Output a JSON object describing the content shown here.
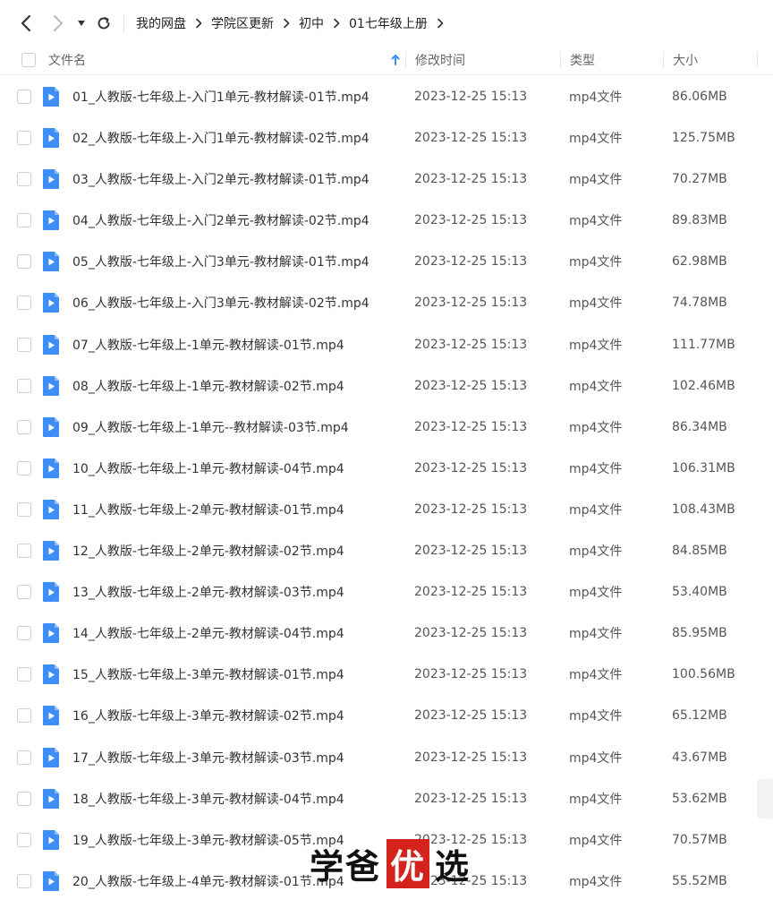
{
  "breadcrumb": [
    "我的网盘",
    "学院区更新",
    "初中",
    "01七年级上册"
  ],
  "header": {
    "name": "文件名",
    "time": "修改时间",
    "type": "类型",
    "size": "大小"
  },
  "colors": {
    "accent": "#3d8ef7",
    "watermark_highlight": "#d4231c"
  },
  "files": [
    {
      "name": "01_人教版-七年级上-入门1单元-教材解读-01节.mp4",
      "time": "2023-12-25 15:13",
      "type": "mp4文件",
      "size": "86.06MB"
    },
    {
      "name": "02_人教版-七年级上-入门1单元-教材解读-02节.mp4",
      "time": "2023-12-25 15:13",
      "type": "mp4文件",
      "size": "125.75MB"
    },
    {
      "name": "03_人教版-七年级上-入门2单元-教材解读-01节.mp4",
      "time": "2023-12-25 15:13",
      "type": "mp4文件",
      "size": "70.27MB"
    },
    {
      "name": "04_人教版-七年级上-入门2单元-教材解读-02节.mp4",
      "time": "2023-12-25 15:13",
      "type": "mp4文件",
      "size": "89.83MB"
    },
    {
      "name": "05_人教版-七年级上-入门3单元-教材解读-01节.mp4",
      "time": "2023-12-25 15:13",
      "type": "mp4文件",
      "size": "62.98MB"
    },
    {
      "name": "06_人教版-七年级上-入门3单元-教材解读-02节.mp4",
      "time": "2023-12-25 15:13",
      "type": "mp4文件",
      "size": "74.78MB"
    },
    {
      "name": "07_人教版-七年级上-1单元-教材解读-01节.mp4",
      "time": "2023-12-25 15:13",
      "type": "mp4文件",
      "size": "111.77MB"
    },
    {
      "name": "08_人教版-七年级上-1单元-教材解读-02节.mp4",
      "time": "2023-12-25 15:13",
      "type": "mp4文件",
      "size": "102.46MB"
    },
    {
      "name": "09_人教版-七年级上-1单元--教材解读-03节.mp4",
      "time": "2023-12-25 15:13",
      "type": "mp4文件",
      "size": "86.34MB"
    },
    {
      "name": "10_人教版-七年级上-1单元-教材解读-04节.mp4",
      "time": "2023-12-25 15:13",
      "type": "mp4文件",
      "size": "106.31MB"
    },
    {
      "name": "11_人教版-七年级上-2单元-教材解读-01节.mp4",
      "time": "2023-12-25 15:13",
      "type": "mp4文件",
      "size": "108.43MB"
    },
    {
      "name": "12_人教版-七年级上-2单元-教材解读-02节.mp4",
      "time": "2023-12-25 15:13",
      "type": "mp4文件",
      "size": "84.85MB"
    },
    {
      "name": "13_人教版-七年级上-2单元-教材解读-03节.mp4",
      "time": "2023-12-25 15:13",
      "type": "mp4文件",
      "size": "53.40MB"
    },
    {
      "name": "14_人教版-七年级上-2单元-教材解读-04节.mp4",
      "time": "2023-12-25 15:13",
      "type": "mp4文件",
      "size": "85.95MB"
    },
    {
      "name": "15_人教版-七年级上-3单元-教材解读-01节.mp4",
      "time": "2023-12-25 15:13",
      "type": "mp4文件",
      "size": "100.56MB"
    },
    {
      "name": "16_人教版-七年级上-3单元-教材解读-02节.mp4",
      "time": "2023-12-25 15:13",
      "type": "mp4文件",
      "size": "65.12MB"
    },
    {
      "name": "17_人教版-七年级上-3单元-教材解读-03节.mp4",
      "time": "2023-12-25 15:13",
      "type": "mp4文件",
      "size": "43.67MB"
    },
    {
      "name": "18_人教版-七年级上-3单元-教材解读-04节.mp4",
      "time": "2023-12-25 15:13",
      "type": "mp4文件",
      "size": "53.62MB"
    },
    {
      "name": "19_人教版-七年级上-3单元-教材解读-05节.mp4",
      "time": "2023-12-25 15:13",
      "type": "mp4文件",
      "size": "70.57MB"
    },
    {
      "name": "20_人教版-七年级上-4单元-教材解读-01节.mp4",
      "time": "2023-12-25 15:13",
      "type": "mp4文件",
      "size": "55.52MB"
    }
  ],
  "watermark": {
    "part1": "学爸",
    "part2": "优",
    "part3": "选"
  }
}
